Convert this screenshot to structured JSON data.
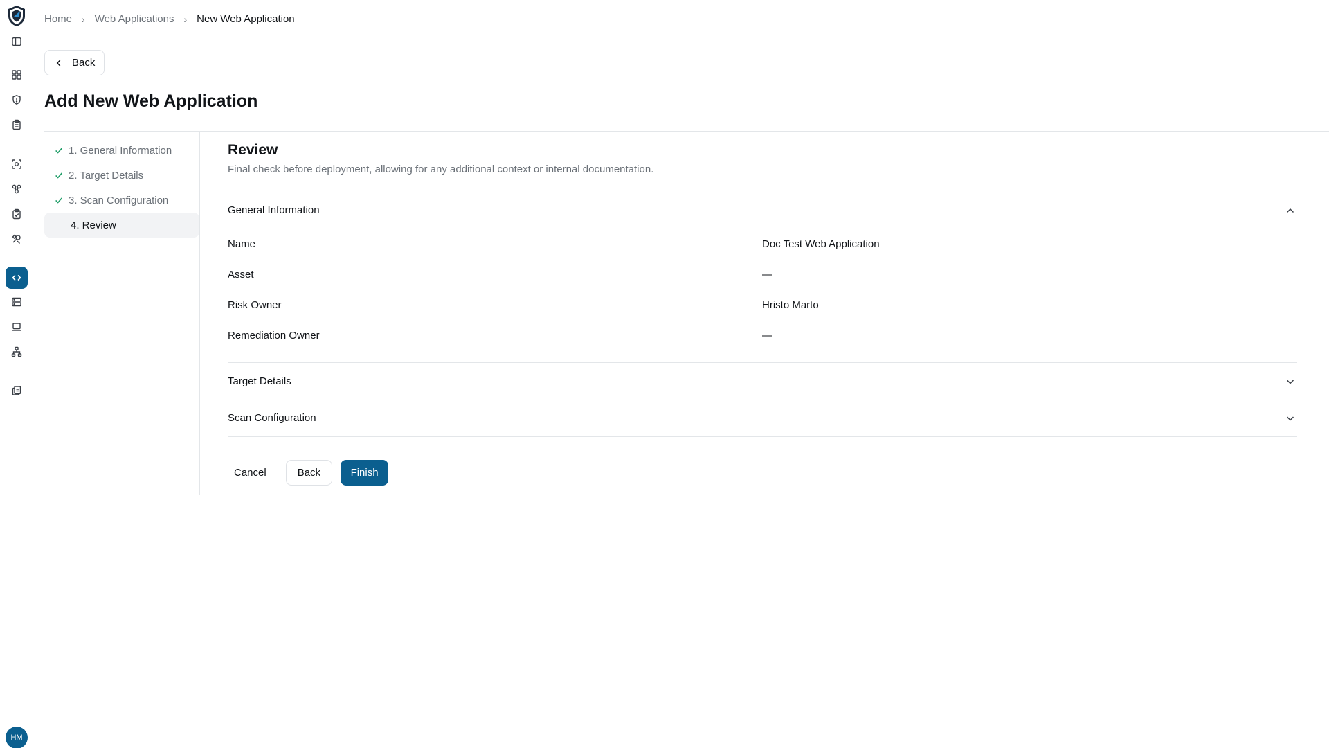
{
  "breadcrumb": {
    "items": [
      "Home",
      "Web Applications",
      "New Web Application"
    ]
  },
  "header": {
    "back_label": "Back",
    "title": "Add New Web Application"
  },
  "steps": [
    {
      "label": "1. General Information",
      "done": true
    },
    {
      "label": "2. Target Details",
      "done": true
    },
    {
      "label": "3. Scan Configuration",
      "done": true
    },
    {
      "label": "4. Review",
      "done": false,
      "active": true
    }
  ],
  "review": {
    "title": "Review",
    "description": "Final check before deployment, allowing for any additional context or internal documentation.",
    "sections": [
      {
        "title": "General Information",
        "expanded": true
      },
      {
        "title": "Target Details",
        "expanded": false
      },
      {
        "title": "Scan Configuration",
        "expanded": false
      }
    ],
    "general": [
      {
        "label": "Name",
        "value": "Doc Test Web Application"
      },
      {
        "label": "Asset",
        "value": "—"
      },
      {
        "label": "Risk Owner",
        "value": "Hristo Marto"
      },
      {
        "label": "Remediation Owner",
        "value": "—"
      }
    ]
  },
  "actions": {
    "cancel": "Cancel",
    "back": "Back",
    "finish": "Finish"
  },
  "user": {
    "initials": "HM"
  },
  "sidebar": {
    "icons": [
      "sidebar-toggle-icon",
      "dashboard-icon",
      "shield-icon",
      "clipboard-icon",
      "scan-icon",
      "integrations-icon",
      "clipboard-check-icon",
      "tools-icon",
      "code-icon",
      "server-icon",
      "laptop-icon",
      "network-icon",
      "reports-icon"
    ],
    "active": "code-icon"
  },
  "colors": {
    "primary": "#0b5f8f",
    "success_check": "#1f9d67",
    "muted_text": "#6b7178"
  }
}
